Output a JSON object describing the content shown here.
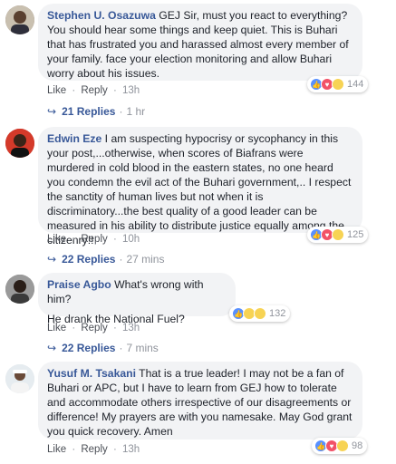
{
  "comments": [
    {
      "author": "Stephen U. Osazuwa",
      "text": "GEJ Sir, must you react to everything? You should hear some things and keep quiet. This is Buhari that has frustrated you and harassed almost every member of your family. face your election monitoring and allow Buhari worry about his issues.",
      "like": "Like",
      "reply": "Reply",
      "time": "13h",
      "reaction_count": "144",
      "replies_label": "21 Replies",
      "replies_time": "1 hr"
    },
    {
      "author": "Edwin Eze",
      "text": "I am suspecting hypocrisy or sycophancy in this your post,...otherwise, when scores of Biafrans were murdered in cold blood in the eastern states, no one heard you condemn the evil act of the Buhari government,.. I respect the sanctity of human lives but not when it is discriminatory...the best quality of a good leader can be measured in his ability to distribute justice equally among the citizenry!!",
      "like": "Like",
      "reply": "Reply",
      "time": "10h",
      "reaction_count": "125",
      "replies_label": "22 Replies",
      "replies_time": "27 mins"
    },
    {
      "author": "Praise Agbo",
      "text": "What's wrong with him?",
      "text2": "He drank the National Fuel?",
      "like": "Like",
      "reply": "Reply",
      "time": "13h",
      "reaction_count": "132",
      "replies_label": "22 Replies",
      "replies_time": "7 mins"
    },
    {
      "author": "Yusuf M. Tsakani",
      "text": "That is a true leader! I may not be a fan of Buhari or APC, but I have to learn from GEJ how to tolerate and accommodate others irrespective of our disagreements or difference! My prayers are with you namesake. May God grant you quick recovery. Amen",
      "like": "Like",
      "reply": "Reply",
      "time": "13h",
      "reaction_count": "98"
    }
  ],
  "separator": "·",
  "colors": {
    "author": "#385898",
    "bubble": "#f2f3f5",
    "like_reaction": "#5890ff",
    "love_reaction": "#f25268",
    "haha_reaction": "#f7d354"
  }
}
